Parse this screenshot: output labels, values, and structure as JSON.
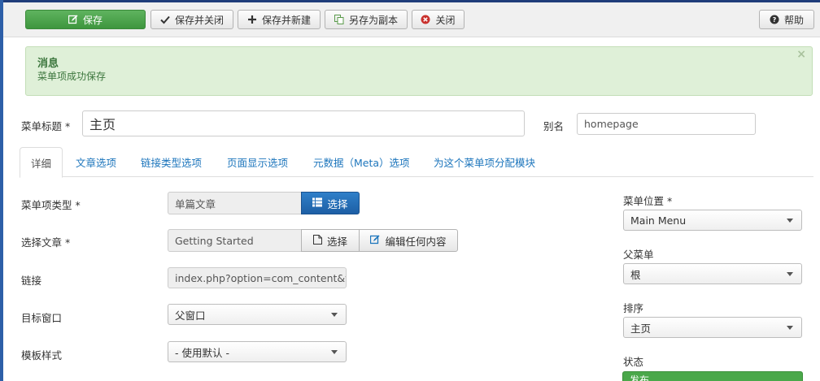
{
  "toolbar": {
    "save": "保存",
    "save_close": "保存并关闭",
    "save_new": "保存并新建",
    "save_copy": "另存为副本",
    "close": "关闭",
    "help": "帮助"
  },
  "message": {
    "title": "消息",
    "text": "菜单项成功保存",
    "close": "×"
  },
  "form": {
    "title_label": "菜单标题 *",
    "title_value": "主页",
    "alias_label": "别名",
    "alias_value": "homepage"
  },
  "tabs": [
    {
      "label": "详细",
      "active": true
    },
    {
      "label": "文章选项"
    },
    {
      "label": "链接类型选项"
    },
    {
      "label": "页面显示选项"
    },
    {
      "label": "元数据（Meta）选项"
    },
    {
      "label": "为这个菜单项分配模块"
    }
  ],
  "details": {
    "menu_type_label": "菜单项类型 *",
    "menu_type_value": "单篇文章",
    "menu_type_select": "选择",
    "article_label": "选择文章 *",
    "article_value": "Getting Started",
    "article_select": "选择",
    "article_edit": "编辑任何内容",
    "link_label": "链接",
    "link_value": "index.php?option=com_content&view",
    "target_label": "目标窗口",
    "target_value": "父窗口",
    "template_label": "模板样式",
    "template_value": "- 使用默认 -"
  },
  "sidebar": {
    "menu_location_label": "菜单位置 *",
    "menu_location_value": "Main Menu",
    "parent_label": "父菜单",
    "parent_value": "根",
    "ordering_label": "排序",
    "ordering_value": "主页",
    "status_label": "状态",
    "status_value": "发布"
  },
  "colors": {
    "save_green": "#4aa84a",
    "select_blue": "#2170b8",
    "alert_bg": "#dff0d8",
    "link_blue": "#1c75bc"
  }
}
